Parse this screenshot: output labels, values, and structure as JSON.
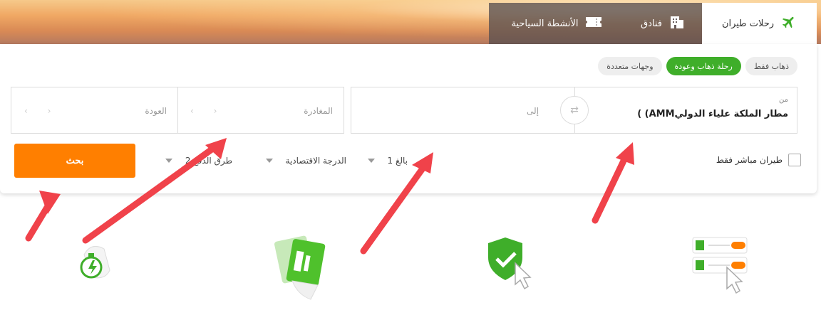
{
  "tabs": [
    {
      "label": "رحلات طيران",
      "icon": "plane-icon",
      "active": true
    },
    {
      "label": "فنادق",
      "icon": "hotel-icon",
      "active": false
    },
    {
      "label": "الأنشطة السياحية",
      "icon": "ticket-icon",
      "active": false
    }
  ],
  "trip_types": [
    "ذهاب فقط",
    "رحلة ذهاب وعودة",
    "وجهات متعددة"
  ],
  "trip_type_selected": "رحلة ذهاب وعودة",
  "from": {
    "label": "من",
    "value": "مطار الملكة علياء الدوليAMM) )"
  },
  "to": {
    "placeholder": "إلى"
  },
  "departure": {
    "label": "المغادرة"
  },
  "return": {
    "label": "العودة"
  },
  "direct_only": {
    "label": "طيران مباشر فقط",
    "checked": false
  },
  "passengers": "1 بالغ",
  "cabin_class": "الدرجة الاقتصادية",
  "payment": "2 طرق الدفع",
  "search_label": "بحث",
  "colors": {
    "accent_green": "#3fae2a",
    "search_orange": "#ff7f00",
    "arrow_red": "#f0424a"
  }
}
